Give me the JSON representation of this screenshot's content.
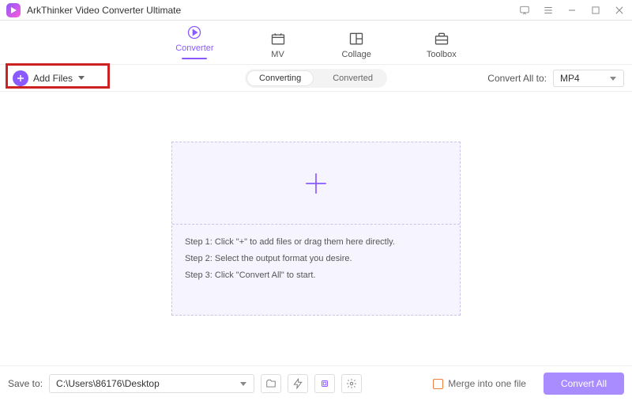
{
  "title": "ArkThinker Video Converter Ultimate",
  "nav": {
    "converter": "Converter",
    "mv": "MV",
    "collage": "Collage",
    "toolbox": "Toolbox"
  },
  "subbar": {
    "add_files": "Add Files",
    "tab_converting": "Converting",
    "tab_converted": "Converted",
    "convert_all_to": "Convert All to:",
    "format": "MP4"
  },
  "steps": {
    "s1": "Step 1: Click \"+\" to add files or drag them here directly.",
    "s2": "Step 2: Select the output format you desire.",
    "s3": "Step 3: Click \"Convert All\" to start."
  },
  "bottom": {
    "save_to": "Save to:",
    "path": "C:\\Users\\86176\\Desktop",
    "merge": "Merge into one file",
    "convert_all": "Convert All"
  }
}
